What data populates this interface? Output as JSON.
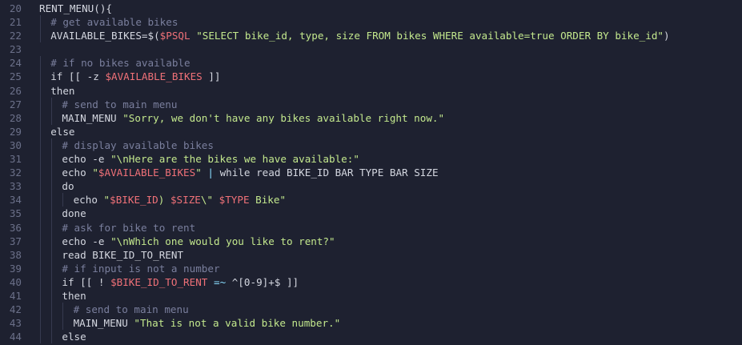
{
  "editor": {
    "colors": {
      "background": "#1e2130",
      "line_number": "#6b7089",
      "comment": "#7a7f9d",
      "string": "#c3e88d",
      "variable": "#f07178",
      "operator": "#89ddff",
      "text": "#d4d7e0"
    },
    "lines": [
      {
        "num": "20",
        "indent": 0,
        "tokens": [
          {
            "t": "RENT_MENU(){",
            "c": "plain"
          }
        ]
      },
      {
        "num": "21",
        "indent": 1,
        "tokens": [
          {
            "t": "# get available bikes",
            "c": "comment"
          }
        ]
      },
      {
        "num": "22",
        "indent": 1,
        "tokens": [
          {
            "t": "AVAILABLE_BIKES=$(",
            "c": "plain"
          },
          {
            "t": "$PSQL",
            "c": "var"
          },
          {
            "t": " ",
            "c": "plain"
          },
          {
            "t": "\"SELECT bike_id, type, size FROM bikes WHERE available=true ORDER BY bike_id\"",
            "c": "string"
          },
          {
            "t": ")",
            "c": "plain"
          }
        ]
      },
      {
        "num": "23",
        "indent": 0,
        "tokens": []
      },
      {
        "num": "24",
        "indent": 1,
        "tokens": [
          {
            "t": "# if no bikes available",
            "c": "comment"
          }
        ]
      },
      {
        "num": "25",
        "indent": 1,
        "tokens": [
          {
            "t": "if [[ -z ",
            "c": "plain"
          },
          {
            "t": "$AVAILABLE_BIKES",
            "c": "var"
          },
          {
            "t": " ]]",
            "c": "plain"
          }
        ]
      },
      {
        "num": "26",
        "indent": 1,
        "tokens": [
          {
            "t": "then",
            "c": "plain"
          }
        ]
      },
      {
        "num": "27",
        "indent": 2,
        "tokens": [
          {
            "t": "# send to main menu",
            "c": "comment"
          }
        ]
      },
      {
        "num": "28",
        "indent": 2,
        "tokens": [
          {
            "t": "MAIN_MENU ",
            "c": "plain"
          },
          {
            "t": "\"Sorry, we don't have any bikes available right now.\"",
            "c": "string"
          }
        ]
      },
      {
        "num": "29",
        "indent": 1,
        "tokens": [
          {
            "t": "else",
            "c": "plain"
          }
        ]
      },
      {
        "num": "30",
        "indent": 2,
        "tokens": [
          {
            "t": "# display available bikes",
            "c": "comment"
          }
        ]
      },
      {
        "num": "31",
        "indent": 2,
        "tokens": [
          {
            "t": "echo -e ",
            "c": "plain"
          },
          {
            "t": "\"\\nHere are the bikes we have available:\"",
            "c": "string"
          }
        ]
      },
      {
        "num": "32",
        "indent": 2,
        "tokens": [
          {
            "t": "echo ",
            "c": "plain"
          },
          {
            "t": "\"",
            "c": "string"
          },
          {
            "t": "$AVAILABLE_BIKES",
            "c": "var"
          },
          {
            "t": "\"",
            "c": "string"
          },
          {
            "t": " ",
            "c": "plain"
          },
          {
            "t": "|",
            "c": "op"
          },
          {
            "t": " while read BIKE_ID BAR TYPE BAR SIZE",
            "c": "plain"
          }
        ]
      },
      {
        "num": "33",
        "indent": 2,
        "tokens": [
          {
            "t": "do",
            "c": "plain"
          }
        ]
      },
      {
        "num": "34",
        "indent": 3,
        "tokens": [
          {
            "t": "echo ",
            "c": "plain"
          },
          {
            "t": "\"",
            "c": "string"
          },
          {
            "t": "$BIKE_ID",
            "c": "var"
          },
          {
            "t": ") ",
            "c": "string"
          },
          {
            "t": "$SIZE",
            "c": "var"
          },
          {
            "t": "\\\" ",
            "c": "string"
          },
          {
            "t": "$TYPE",
            "c": "var"
          },
          {
            "t": " Bike\"",
            "c": "string"
          }
        ]
      },
      {
        "num": "35",
        "indent": 2,
        "tokens": [
          {
            "t": "done",
            "c": "plain"
          }
        ]
      },
      {
        "num": "36",
        "indent": 2,
        "tokens": [
          {
            "t": "# ask for bike to rent",
            "c": "comment"
          }
        ]
      },
      {
        "num": "37",
        "indent": 2,
        "tokens": [
          {
            "t": "echo -e ",
            "c": "plain"
          },
          {
            "t": "\"\\nWhich one would you like to rent?\"",
            "c": "string"
          }
        ]
      },
      {
        "num": "38",
        "indent": 2,
        "tokens": [
          {
            "t": "read BIKE_ID_TO_RENT",
            "c": "plain"
          }
        ]
      },
      {
        "num": "39",
        "indent": 2,
        "tokens": [
          {
            "t": "# if input is not a number",
            "c": "comment"
          }
        ]
      },
      {
        "num": "40",
        "indent": 2,
        "tokens": [
          {
            "t": "if [[ ! ",
            "c": "plain"
          },
          {
            "t": "$BIKE_ID_TO_RENT",
            "c": "var"
          },
          {
            "t": " ",
            "c": "plain"
          },
          {
            "t": "=~",
            "c": "op"
          },
          {
            "t": " ^[0-9]+$ ]]",
            "c": "plain"
          }
        ]
      },
      {
        "num": "41",
        "indent": 2,
        "tokens": [
          {
            "t": "then",
            "c": "plain"
          }
        ]
      },
      {
        "num": "42",
        "indent": 3,
        "tokens": [
          {
            "t": "# send to main menu",
            "c": "comment"
          }
        ]
      },
      {
        "num": "43",
        "indent": 3,
        "tokens": [
          {
            "t": "MAIN_MENU ",
            "c": "plain"
          },
          {
            "t": "\"That is not a valid bike number.\"",
            "c": "string"
          }
        ]
      },
      {
        "num": "44",
        "indent": 2,
        "tokens": [
          {
            "t": "else",
            "c": "plain"
          }
        ]
      }
    ]
  }
}
